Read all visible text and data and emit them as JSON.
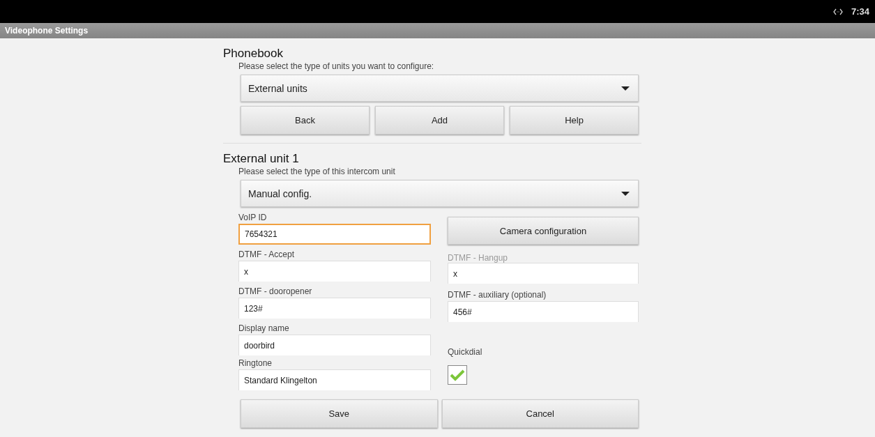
{
  "status_bar": {
    "time": "7:34"
  },
  "window": {
    "title": "Videophone Settings"
  },
  "phonebook": {
    "heading": "Phonebook",
    "prompt": "Please select the type of units you want to configure:",
    "dropdown": "External units",
    "buttons": [
      "Back",
      "Add",
      "Help"
    ]
  },
  "unit": {
    "heading": "External unit 1",
    "prompt": "Please select the type of this intercom unit",
    "dropdown": "Manual config.",
    "left_fields": [
      {
        "label": "VoIP ID",
        "value": "7654321",
        "focused": true,
        "disabled": false
      },
      {
        "label": "DTMF - Accept",
        "value": "x",
        "focused": false,
        "disabled": false
      },
      {
        "label": "DTMF - dooropener",
        "value": "123#",
        "focused": false,
        "disabled": false
      },
      {
        "label": "Display name",
        "value": "doorbird",
        "focused": false,
        "disabled": false
      },
      {
        "label": "Ringtone",
        "value": "Standard Klingelton",
        "focused": false,
        "disabled": false
      }
    ],
    "camera_button": "Camera configuration",
    "right_fields": [
      {
        "label": "DTMF - Hangup",
        "value": "x",
        "focused": false,
        "disabled": true
      },
      {
        "label": "DTMF - auxiliary (optional)",
        "value": "456#",
        "focused": false,
        "disabled": false
      }
    ],
    "quickdial": {
      "label": "Quickdial",
      "checked": true
    },
    "buttons": [
      "Save",
      "Cancel"
    ]
  }
}
